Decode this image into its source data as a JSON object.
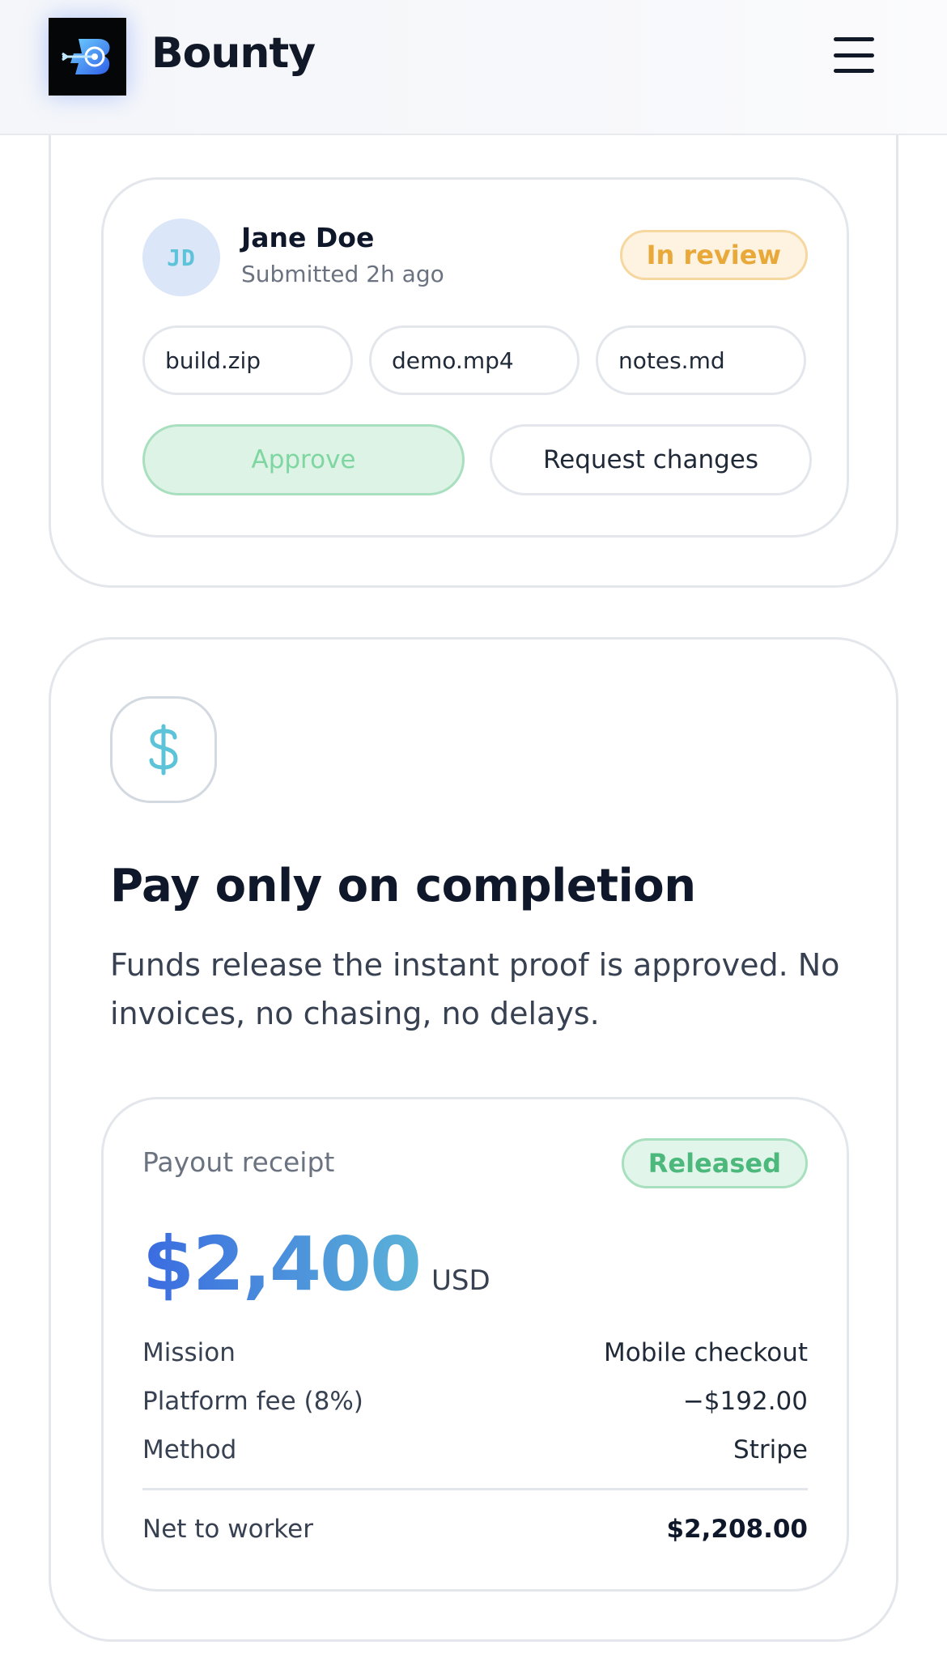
{
  "header": {
    "brand": "Bounty",
    "logo_icon": "bounty-target-logo",
    "menu_icon": "hamburger-menu-icon"
  },
  "submission": {
    "avatar_initials": "JD",
    "name": "Jane Doe",
    "time": "Submitted 2h ago",
    "status": "In review",
    "files": [
      "build.zip",
      "demo.mp4",
      "notes.md"
    ],
    "approve_label": "Approve",
    "changes_label": "Request changes"
  },
  "pay": {
    "icon": "dollar-icon",
    "title": "Pay only on completion",
    "description": "Funds release the instant proof is approved. No invoices, no chasing, no delays."
  },
  "receipt": {
    "label": "Payout receipt",
    "status": "Released",
    "amount": "$2,400",
    "currency": "USD",
    "rows": [
      {
        "label": "Mission",
        "value": "Mobile checkout"
      },
      {
        "label": "Platform fee (8%)",
        "value": "−$192.00"
      },
      {
        "label": "Method",
        "value": "Stripe"
      }
    ],
    "net_label": "Net to worker",
    "net_value": "$2,208.00"
  },
  "colors": {
    "accent_blue": "#3a6be0",
    "accent_cyan": "#5bb3d8",
    "review_amber": "#e8a93a",
    "released_green": "#4cb87c"
  }
}
